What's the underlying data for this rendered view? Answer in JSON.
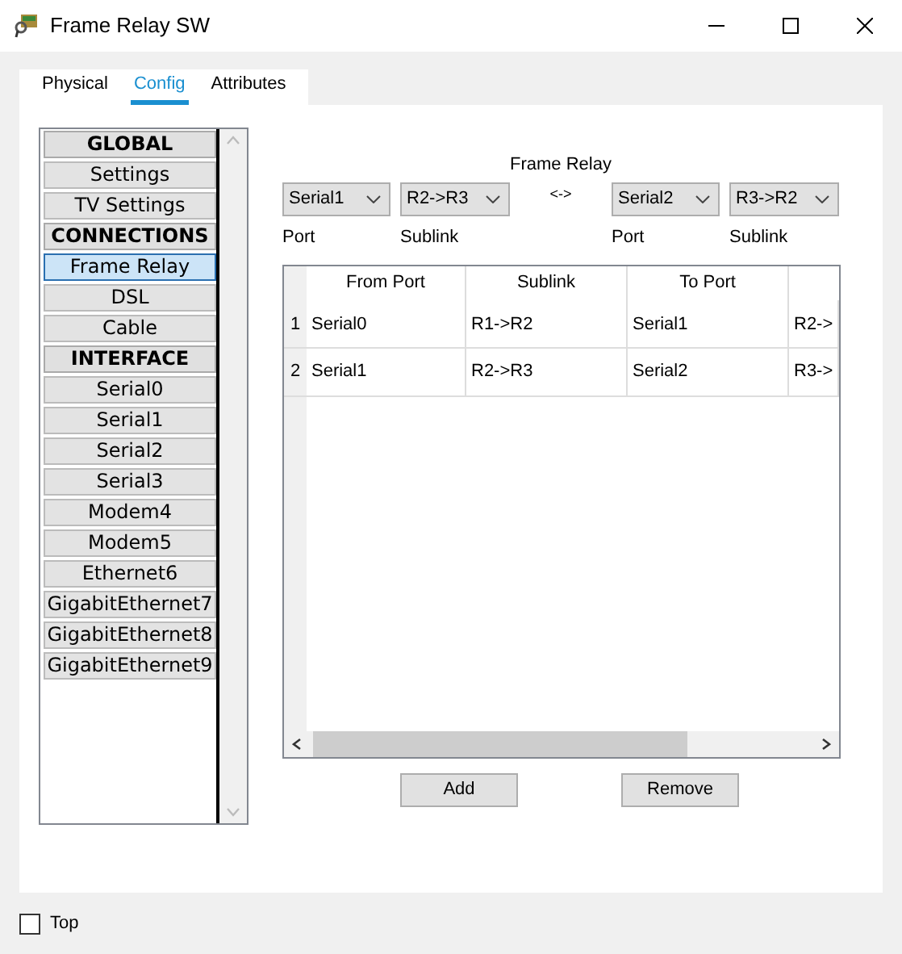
{
  "window": {
    "title": "Frame Relay SW"
  },
  "tabs": [
    {
      "label": "Physical",
      "selected": false
    },
    {
      "label": "Config",
      "selected": true
    },
    {
      "label": "Attributes",
      "selected": false
    }
  ],
  "sidebar": {
    "items": [
      {
        "label": "GLOBAL",
        "kind": "header"
      },
      {
        "label": "Settings",
        "kind": "item",
        "selected": false
      },
      {
        "label": "TV Settings",
        "kind": "item",
        "selected": false
      },
      {
        "label": "CONNECTIONS",
        "kind": "header"
      },
      {
        "label": "Frame Relay",
        "kind": "item",
        "selected": true
      },
      {
        "label": "DSL",
        "kind": "item",
        "selected": false
      },
      {
        "label": "Cable",
        "kind": "item",
        "selected": false
      },
      {
        "label": "INTERFACE",
        "kind": "header"
      },
      {
        "label": "Serial0",
        "kind": "item",
        "selected": false
      },
      {
        "label": "Serial1",
        "kind": "item",
        "selected": false
      },
      {
        "label": "Serial2",
        "kind": "item",
        "selected": false
      },
      {
        "label": "Serial3",
        "kind": "item",
        "selected": false
      },
      {
        "label": "Modem4",
        "kind": "item",
        "selected": false
      },
      {
        "label": "Modem5",
        "kind": "item",
        "selected": false
      },
      {
        "label": "Ethernet6",
        "kind": "item",
        "selected": false
      },
      {
        "label": "GigabitEthernet7",
        "kind": "item",
        "selected": false
      },
      {
        "label": "GigabitEthernet8",
        "kind": "item",
        "selected": false
      },
      {
        "label": "GigabitEthernet9",
        "kind": "item",
        "selected": false
      }
    ]
  },
  "section_title": "Frame Relay",
  "selectors": {
    "from_port": {
      "value": "Serial1",
      "label": "Port"
    },
    "from_sublink": {
      "value": "R2->R3",
      "label": "Sublink"
    },
    "separator": "<->",
    "to_port": {
      "value": "Serial2",
      "label": "Port"
    },
    "to_sublink": {
      "value": "R3->R2",
      "label": "Sublink"
    }
  },
  "table": {
    "columns": [
      "From Port",
      "Sublink",
      "To Port"
    ],
    "rows": [
      {
        "number": "1",
        "cells": [
          "Serial0",
          "R1->R2",
          "Serial1",
          "R2->"
        ]
      },
      {
        "number": "2",
        "cells": [
          "Serial1",
          "R2->R3",
          "Serial2",
          "R3->"
        ]
      }
    ]
  },
  "buttons": [
    "Add",
    "Remove"
  ],
  "top_checkbox": {
    "label": "Top",
    "checked": false
  }
}
